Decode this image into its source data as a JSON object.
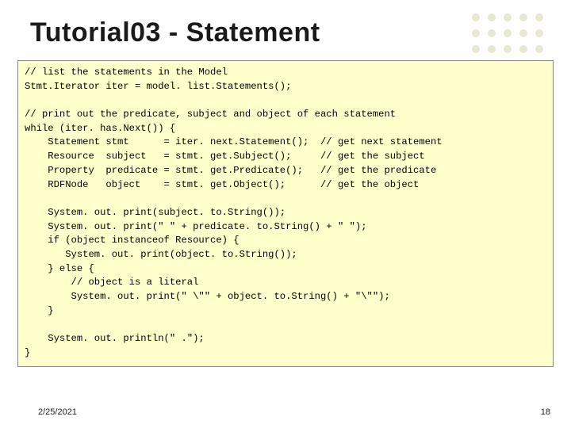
{
  "title": "Tutorial03 - Statement",
  "code": "// list the statements in the Model\nStmt.Iterator iter = model. list.Statements();\n\n// print out the predicate, subject and object of each statement\nwhile (iter. has.Next()) {\n    Statement stmt      = iter. next.Statement();  // get next statement\n    Resource  subject   = stmt. get.Subject();     // get the subject\n    Property  predicate = stmt. get.Predicate();   // get the predicate\n    RDFNode   object    = stmt. get.Object();      // get the object\n\n    System. out. print(subject. to.String());\n    System. out. print(\" \" + predicate. to.String() + \" \");\n    if (object instanceof Resource) {\n       System. out. print(object. to.String());\n    } else {\n        // object is a literal\n        System. out. print(\" \\\"\" + object. to.String() + \"\\\"\");\n    }\n\n    System. out. println(\" .\");\n}",
  "footer": {
    "date": "2/25/2021",
    "page": "18"
  },
  "decor": {
    "dot_color": "#e8e8d0"
  }
}
